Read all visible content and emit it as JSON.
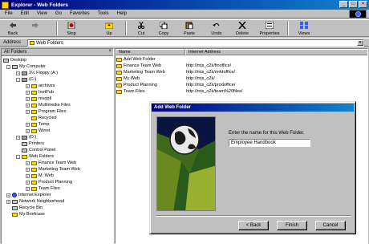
{
  "window": {
    "title": "Explorer - Web Folders"
  },
  "menu": [
    "File",
    "Edit",
    "View",
    "Go",
    "Favorites",
    "Tools",
    "Help"
  ],
  "toolbar": [
    {
      "label": "Back",
      "icon": "back-arrow-icon"
    },
    {
      "label": "",
      "icon": "forward-arrow-icon"
    },
    {
      "label": "Stop",
      "icon": "stop-icon"
    },
    {
      "label": "Up",
      "icon": "up-folder-icon"
    },
    {
      "label": "Cut",
      "icon": "scissors-icon"
    },
    {
      "label": "Copy",
      "icon": "copy-icon"
    },
    {
      "label": "Paste",
      "icon": "paste-icon"
    },
    {
      "label": "Undo",
      "icon": "undo-icon"
    },
    {
      "label": "Delete",
      "icon": "delete-x-icon"
    },
    {
      "label": "Properties",
      "icon": "properties-icon"
    },
    {
      "label": "Views",
      "icon": "views-icon"
    }
  ],
  "address": {
    "label": "Address",
    "value": "Web Folders"
  },
  "tree": {
    "header": "All Folders",
    "nodes": [
      {
        "label": "Desktop",
        "icon": "desktop-icon"
      },
      {
        "label": "My Computer",
        "icon": "computer-icon"
      },
      {
        "label": "3½ Floppy (A:)",
        "icon": "floppy-drive-icon"
      },
      {
        "label": "(C:)",
        "icon": "hard-drive-icon"
      },
      {
        "label": "archives",
        "icon": "folder-icon"
      },
      {
        "label": "InetPub",
        "icon": "folder-icon"
      },
      {
        "label": "msoptl",
        "icon": "folder-icon"
      },
      {
        "label": "Multimedia Files",
        "icon": "folder-icon"
      },
      {
        "label": "Program Files",
        "icon": "folder-icon"
      },
      {
        "label": "Recycled",
        "icon": "recycle-bin-icon"
      },
      {
        "label": "Temp",
        "icon": "folder-icon"
      },
      {
        "label": "Winnt",
        "icon": "folder-icon"
      },
      {
        "label": "(D:)",
        "icon": "cd-drive-icon"
      },
      {
        "label": "Printers",
        "icon": "printer-icon"
      },
      {
        "label": "Control Panel",
        "icon": "control-panel-icon"
      },
      {
        "label": "Web Folders",
        "icon": "web-folder-icon"
      },
      {
        "label": "Finance Team Web",
        "icon": "web-folder-icon"
      },
      {
        "label": "Marketing Team Web",
        "icon": "web-folder-icon"
      },
      {
        "label": "M. Web",
        "icon": "web-folder-icon"
      },
      {
        "label": "Product Planning",
        "icon": "web-folder-icon"
      },
      {
        "label": "Team Files",
        "icon": "web-folder-icon"
      },
      {
        "label": "Internet Explorer",
        "icon": "internet-explorer-icon"
      },
      {
        "label": "Network Neighborhood",
        "icon": "network-icon"
      },
      {
        "label": "Recycle Bin",
        "icon": "recycle-bin-icon"
      },
      {
        "label": "My Briefcase",
        "icon": "briefcase-icon"
      }
    ]
  },
  "list": {
    "columns": [
      "Name",
      "Internet Address"
    ],
    "rows": [
      {
        "name": "Add Web Folder",
        "address": ""
      },
      {
        "name": "Finance Team Web",
        "address": "http://mis_o2k/finoffice/"
      },
      {
        "name": "Marketing Team Web",
        "address": "http://mis_o2k/mrktoffice/"
      },
      {
        "name": "My Web",
        "address": "http://mis_o2k/"
      },
      {
        "name": "Product Planning",
        "address": "http://mis_o2k/prodoffice/"
      },
      {
        "name": "Team Files",
        "address": "http://mis_o2k/team%20files/"
      }
    ]
  },
  "dialog": {
    "title": "Add Web Folder",
    "prompt": "Enter the name for this Web Folder.",
    "input_value": "Employee Handbook",
    "back": "< Back",
    "finish": "Finish",
    "cancel": "Cancel"
  },
  "colors": {
    "title_start": "#000080",
    "title_end": "#1084d0",
    "face": "#c0c0c0"
  }
}
